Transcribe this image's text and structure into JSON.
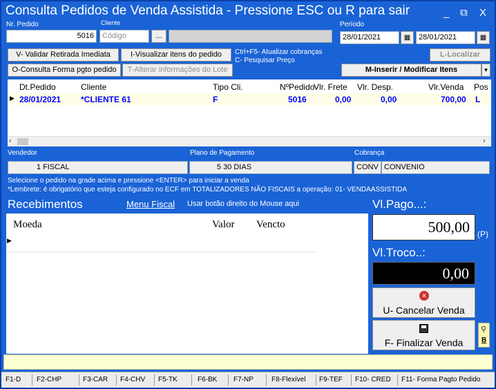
{
  "window": {
    "title": "Consulta Pedidos de Venda Assistida - Pressione ESC ou R para sair",
    "minimize": "_",
    "restore": "⧉",
    "close": "X"
  },
  "header": {
    "nr_pedido_label": "Nr. Pedido",
    "nr_pedido_value": "5016",
    "cliente_label": "Cliente",
    "cliente_placeholder": "Código",
    "cliente_button": "...",
    "periodo_label": "Período",
    "date_from": "28/01/2021",
    "date_to": "28/01/2021"
  },
  "actions": {
    "validar": "V- Validar Retirada Imediata",
    "visualizar": "I-Visualizar itens do pedido",
    "consulta_forma": "O-Consulta Forma pgto pedido",
    "alterar_lote": "T-Alterar informações do Lote",
    "localizar": "L-Localizar",
    "inserir": "M-Inserir / Modificar Itens",
    "hint1": "Ctrl+F5- Atualizar cobranças",
    "hint2": "C- Pesquisar Preço"
  },
  "orders": {
    "columns": [
      "Dt.Pedido",
      "Cliente",
      "Tipo Cli.",
      "NºPedido",
      "Vlr. Frete",
      "Vlr. Desp.",
      "Vlr.Venda",
      "Pos"
    ],
    "rows": [
      {
        "data": "28/01/2021",
        "cliente": "*CLIENTE 61",
        "tipo": "F",
        "numero": "5016",
        "frete": "0,00",
        "desp": "0,00",
        "venda": "700,00",
        "pos": "L"
      }
    ]
  },
  "info": {
    "vendedor_label": "Vendedor",
    "vendedor_code": "1",
    "vendedor_name": "FISCAL",
    "plano_label": "Plano de Pagamento",
    "plano_code": "5",
    "plano_name": "30 DIAS",
    "cobranca_label": "Cobrança",
    "cobranca_code": "CONV",
    "cobranca_name": "CONVENIO"
  },
  "messages": {
    "line1": "Selecione o pedido na grade acima e pressione <ENTER> para iniciar a venda",
    "line2": "*Lembrete: é obrigatório que esteja configurado  no ECF em TOTALIZADORES NÃO FISCAIS a operação: 01- VENDAASSISTIDA"
  },
  "recebimentos": {
    "title": "Recebimentos",
    "menu_fiscal": "Menu Fiscal",
    "hint": "Usar botão direito do Mouse aqui",
    "columns": [
      "Moeda",
      "Valor",
      "Vencto"
    ]
  },
  "payment": {
    "pago_label": "Vl.Pago...:",
    "pago_value": "500,00",
    "pago_suffix": "(P)",
    "troco_label": "Vl.Troco..:",
    "troco_value": "0,00",
    "cancelar": "U- Cancelar Venda",
    "finalizar": "F- Finalizar Venda",
    "side_letter": "B"
  },
  "fkeys": [
    "F1-D",
    "F2-CHP",
    "F3-CAR",
    "F4-CHV",
    "F5-TK",
    "F6-BK",
    "F7-NP",
    "F8-Flexível",
    "F9-TEF",
    "F10- CRED",
    "F11- Forma Pagto Pedido"
  ],
  "colors": {
    "window_bg": "#1a63d6",
    "row_text": "#0000ff",
    "footer_bg": "#ffffd4"
  }
}
